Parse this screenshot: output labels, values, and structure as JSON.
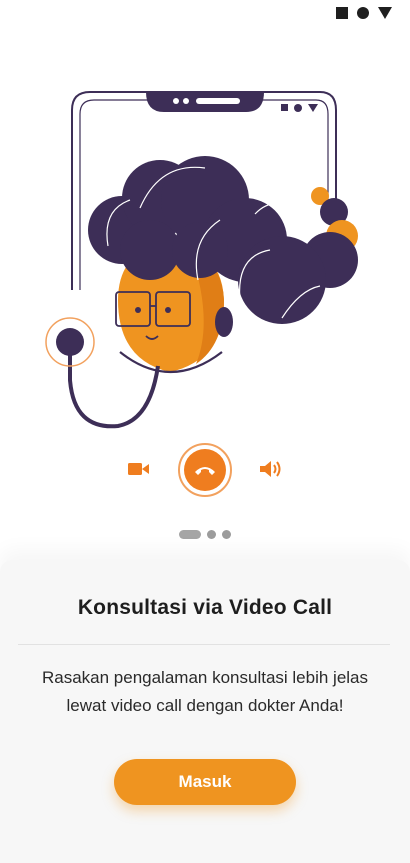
{
  "status_bar": {
    "icons": [
      "square-icon",
      "circle-icon",
      "triangle-down-icon"
    ]
  },
  "illustration": {
    "name": "doctor-video-call-illustration"
  },
  "call_controls": {
    "icons": [
      "video-camera-icon",
      "end-call-icon",
      "speaker-icon"
    ]
  },
  "pager": {
    "pages": 3,
    "active_index": 0
  },
  "card": {
    "title": "Konsultasi via Video Call",
    "description": "Rasakan pengalaman konsultasi lebih jelas lewat video call dengan dokter Anda!",
    "button_label": "Masuk"
  },
  "colors": {
    "accent": "#ef9420",
    "dark_purple": "#3d2e57",
    "card_bg": "#f7f7f7"
  }
}
